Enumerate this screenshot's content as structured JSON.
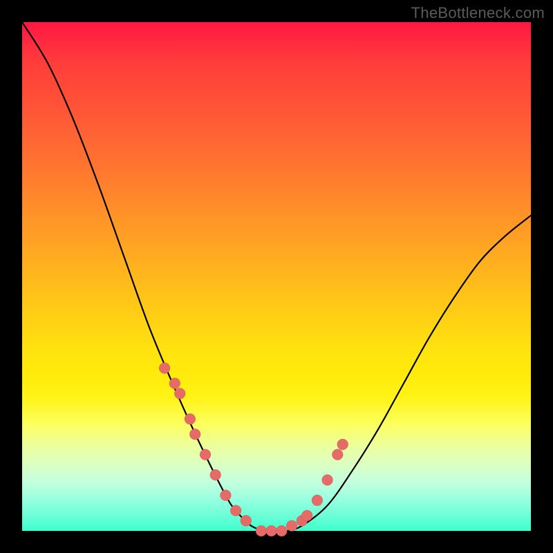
{
  "watermark": "TheBottleneck.com",
  "chart_data": {
    "type": "line",
    "title": "",
    "xlabel": "",
    "ylabel": "",
    "xlim": [
      0,
      100
    ],
    "ylim": [
      0,
      100
    ],
    "grid": false,
    "legend": null,
    "series": [
      {
        "name": "bottleneck-curve",
        "x": [
          0,
          5,
          10,
          15,
          20,
          25,
          30,
          35,
          40,
          42,
          45,
          48,
          50,
          52,
          55,
          60,
          65,
          70,
          75,
          80,
          85,
          90,
          95,
          100
        ],
        "y": [
          100,
          92,
          81,
          68,
          54,
          40,
          28,
          17,
          7,
          4,
          1,
          0,
          0,
          0,
          1,
          5,
          12,
          20,
          29,
          38,
          46,
          53,
          58,
          62
        ]
      }
    ],
    "scatter_points": {
      "name": "sample-points",
      "x": [
        28,
        30,
        31,
        33,
        34,
        36,
        38,
        40,
        42,
        44,
        47,
        49,
        51,
        53,
        55,
        56,
        58,
        60,
        62,
        63
      ],
      "y": [
        32,
        29,
        27,
        22,
        19,
        15,
        11,
        7,
        4,
        2,
        0,
        0,
        0,
        1,
        2,
        3,
        6,
        10,
        15,
        17
      ]
    },
    "gradient_colors": {
      "top": "#ff1744",
      "mid": "#ffe40e",
      "bottom": "#1bffc4"
    },
    "point_color": "#e66a66"
  }
}
